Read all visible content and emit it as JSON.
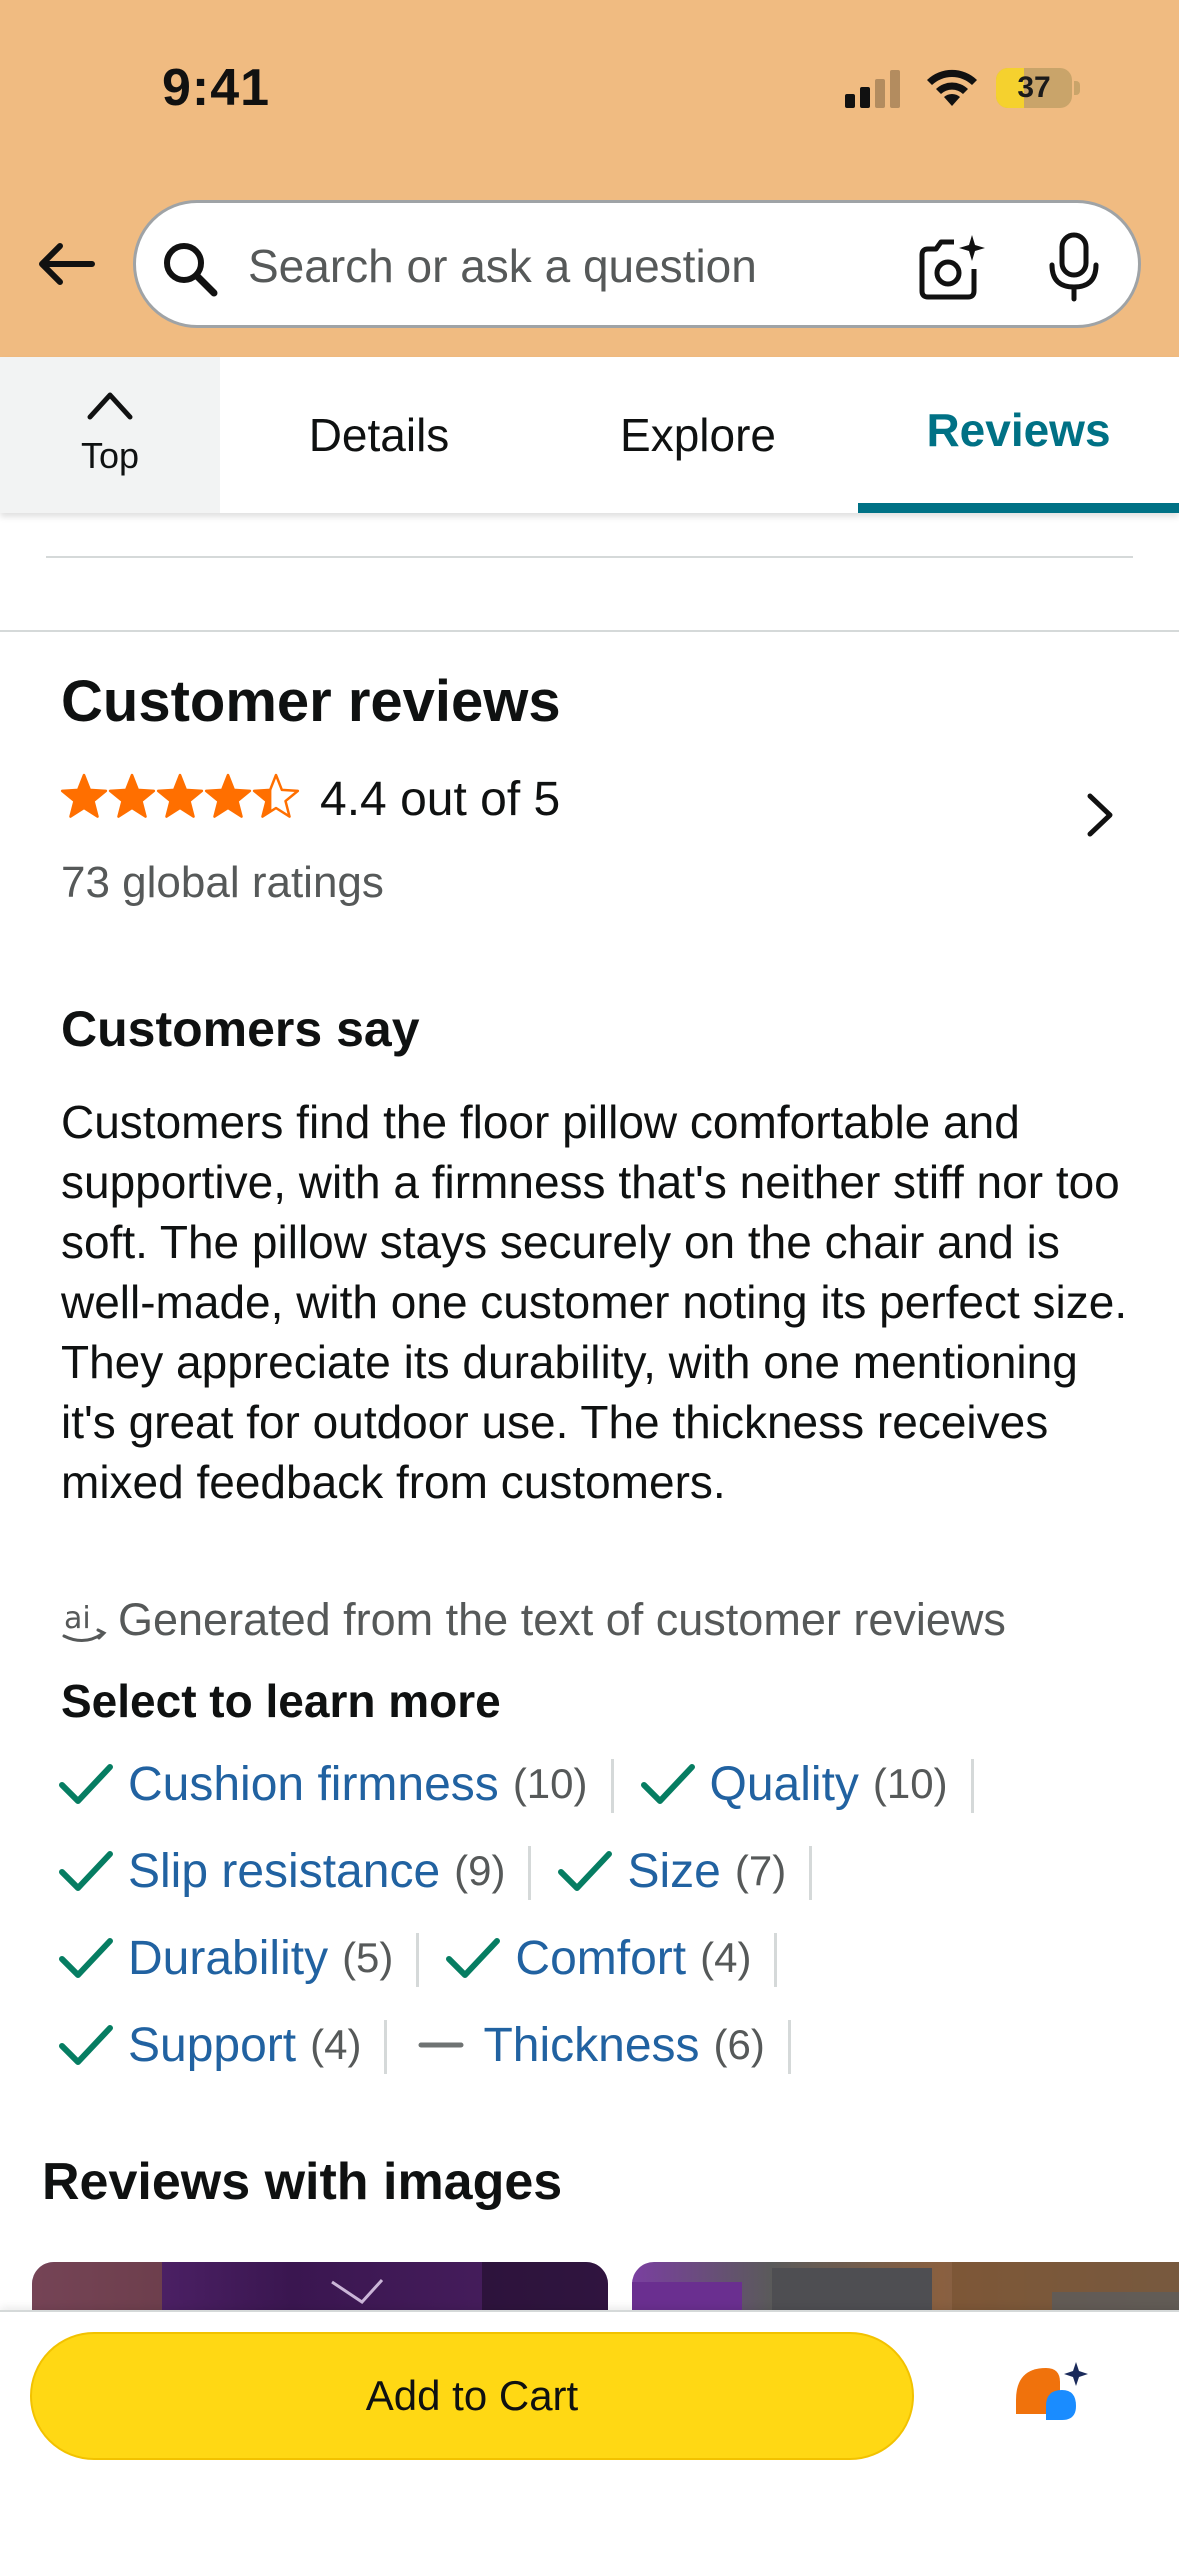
{
  "status_bar": {
    "time": "9:41",
    "battery_level": "37",
    "battery_fraction": 0.37
  },
  "search": {
    "placeholder": "Search or ask a question",
    "icons": [
      "back-arrow-icon",
      "search-icon",
      "camera-icon",
      "microphone-icon"
    ]
  },
  "tabs": {
    "top_label": "Top",
    "items": [
      {
        "label": "Details",
        "active": false
      },
      {
        "label": "Explore",
        "active": false
      },
      {
        "label": "Reviews",
        "active": true
      }
    ]
  },
  "reviews": {
    "heading": "Customer reviews",
    "rating_value": 4.4,
    "rating_text": "4.4 out of 5",
    "global_ratings": "73 global ratings",
    "star_color": "#ff6f00"
  },
  "customers_say": {
    "heading": "Customers say",
    "body": "Customers find the floor pillow comfortable and supportive, with a firmness that's neither stiff nor too soft. The pillow stays securely on the chair and is well-made, with one customer noting its perfect size. They appreciate its durability, with one mentioning it's great for outdoor use. The thickness receives mixed feedback from customers.",
    "ai_note": "Generated from the text of customer reviews"
  },
  "learn_more": {
    "heading": "Select to learn more",
    "chips": [
      [
        {
          "label": "Cushion firmness",
          "count": "(10)",
          "sentiment": "positive"
        },
        {
          "label": "Quality",
          "count": "(10)",
          "sentiment": "positive"
        }
      ],
      [
        {
          "label": "Slip resistance",
          "count": "(9)",
          "sentiment": "positive"
        },
        {
          "label": "Size",
          "count": "(7)",
          "sentiment": "positive"
        }
      ],
      [
        {
          "label": "Durability",
          "count": "(5)",
          "sentiment": "positive"
        },
        {
          "label": "Comfort",
          "count": "(4)",
          "sentiment": "positive"
        }
      ],
      [
        {
          "label": "Support",
          "count": "(4)",
          "sentiment": "positive"
        },
        {
          "label": "Thickness",
          "count": "(6)",
          "sentiment": "mixed"
        }
      ]
    ]
  },
  "images_section": {
    "heading": "Reviews with images"
  },
  "bottom_bar": {
    "add_to_cart": "Add to Cart",
    "assistant_icon": "rufus-icon"
  },
  "colors": {
    "header_bg": "#f0bb81",
    "accent": "#007185",
    "link": "#2162a1",
    "check": "#067d62",
    "button": "#ffd814"
  }
}
